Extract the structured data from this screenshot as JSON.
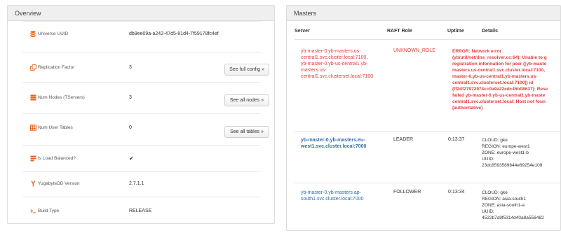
{
  "overview": {
    "title": "Overview",
    "rows": [
      {
        "icon": "database-icon",
        "label": "Universe UUID",
        "value": "db9ee09a-a242-47d5-81d4-7f59178fc4ef",
        "button": ""
      },
      {
        "icon": "copy-icon",
        "label": "Replication Factor",
        "value": "3",
        "button": "See full config »"
      },
      {
        "icon": "servers-icon",
        "label": "Num Nodes (TServers)",
        "value": "3",
        "button": "See all nodes »"
      },
      {
        "icon": "table-icon",
        "label": "Num User Tables",
        "value": "0",
        "button": "See all tables »"
      },
      {
        "icon": "balance-icon",
        "label": "Is Load Balanced?",
        "value": "✔",
        "button": ""
      },
      {
        "icon": "yugabyte-icon",
        "label": "YugabyteDB Version",
        "value": "2.7.1.1",
        "button": ""
      },
      {
        "icon": "terminal-icon",
        "label": "Build Type",
        "value": "RELEASE",
        "button": ""
      }
    ]
  },
  "masters": {
    "title": "Masters",
    "headers": {
      "server": "Server",
      "role": "RAFT Role",
      "uptime": "Uptime",
      "details": "Details"
    },
    "rows": [
      {
        "server": [
          "yb-master-0.yb-masters.us-",
          "central1.svc.cluster.local:7100,",
          "yb-master-0.yb-us-central1.yb-",
          "masters.us-",
          "central1.svc.clusterset.local:7100"
        ],
        "role": "UNKNOWN_ROLE",
        "uptime": "",
        "details": [
          "ERROR: Network error",
          "(yb/util/net/dns_resolver.cc:64): Unable to g",
          "registration information for peer ([yb-maste",
          "masters.us-central1.svc.cluster.local:7100,",
          "master-0.yb-us-central1.yb-masters.us-",
          "central1.svc.clusterset.local:7100]) id",
          "(ff2df27972974cc0a9a22edc45b08637): Rese",
          "failed yb-master-0.yb-us-central1.yb-maste",
          "central1.svc.clusterset.local: Host not foun",
          "(authoritative)"
        ]
      },
      {
        "server": [
          "yb-master-0.yb-masters.eu-",
          "west1.svc.cluster.local:7000"
        ],
        "role": "LEADER",
        "uptime": "0:13:37",
        "details": [
          "CLOUD: gke",
          "REGION: europe-west1",
          "ZONE: europe-west1-b",
          "UUID:",
          "23dc8593589844e69254e109"
        ]
      },
      {
        "server": [
          "yb-master-0.yb-masters.ap-",
          "south1.svc.cluster.local:7000"
        ],
        "role": "FOLLOWER",
        "uptime": "0:13:34",
        "details": [
          "CLOUD: gke",
          "REGION: asia-south1",
          "ZONE: asia-south1-a",
          "UUID:",
          "4522b7a9f5314d40a8a556482"
        ]
      }
    ]
  },
  "colors": {
    "error": "#e53b3b",
    "link": "#2f6ea8",
    "icon": "#e8611a"
  }
}
